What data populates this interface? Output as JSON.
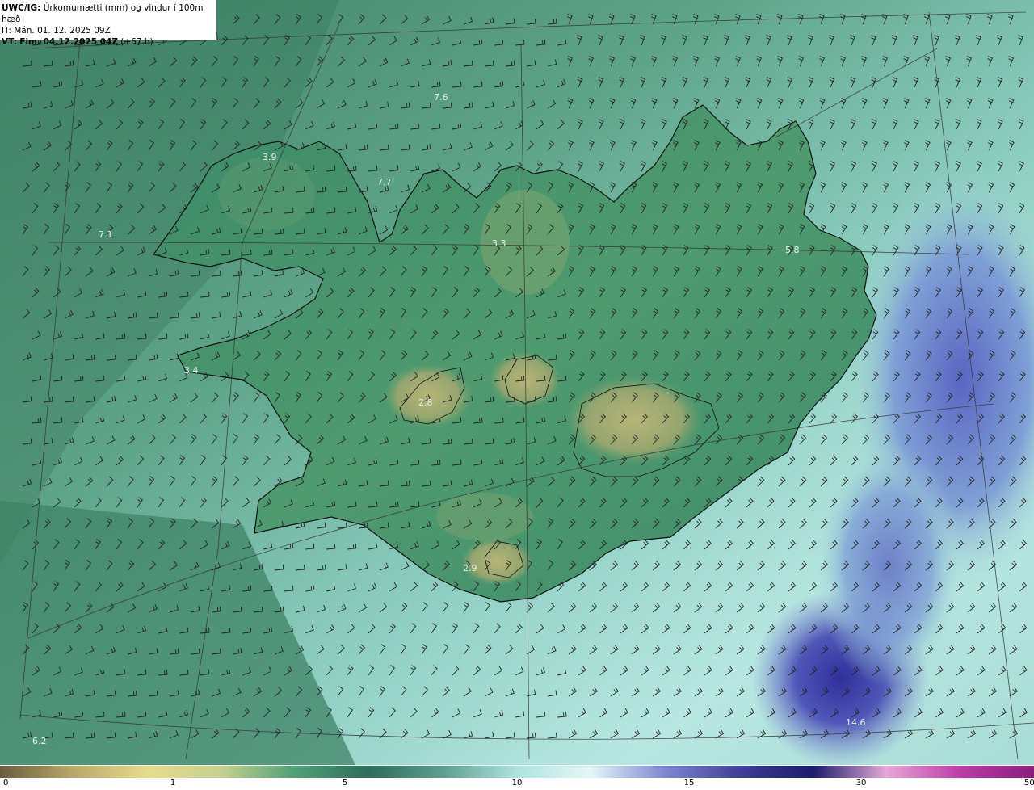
{
  "header": {
    "product": "UWC/IG:",
    "title": "Úrkomumætti (mm) og vindur í 100m hæð",
    "it_label": "IT:",
    "it_value": "Mán. 01. 12. 2025 09Z",
    "vt_label": "VT:",
    "vt_value": "Fim. 04.12.2025 04Z",
    "vt_offset": "(+67 h)"
  },
  "map": {
    "value_labels": [
      "7.6",
      "3.9",
      "7.7",
      "7.1",
      "3.3",
      "5.8",
      "3.4",
      "2.8",
      "2.9",
      "14.6",
      "6.2"
    ],
    "colors": {
      "land_low": "#a9ad6e",
      "land": "#3f8f6d",
      "sea": "#4f9e8a",
      "sea_light": "#a9e1dc",
      "sea_high": "#4b4fb0",
      "coast": "#111111"
    }
  },
  "legend": {
    "ticks": [
      "0",
      "1",
      "5",
      "10",
      "15",
      "30",
      "50"
    ],
    "stops": [
      "#6b5c3e",
      "#b9a868",
      "#e7dc8d",
      "#c6d18e",
      "#4f9f76",
      "#2d6d5a",
      "#5f9f92",
      "#aee3df",
      "#e4f7f8",
      "#7f86d2",
      "#3f3f9d",
      "#1a1a6e",
      "#e5a8d6",
      "#c03aa8",
      "#8a1c7a"
    ]
  }
}
